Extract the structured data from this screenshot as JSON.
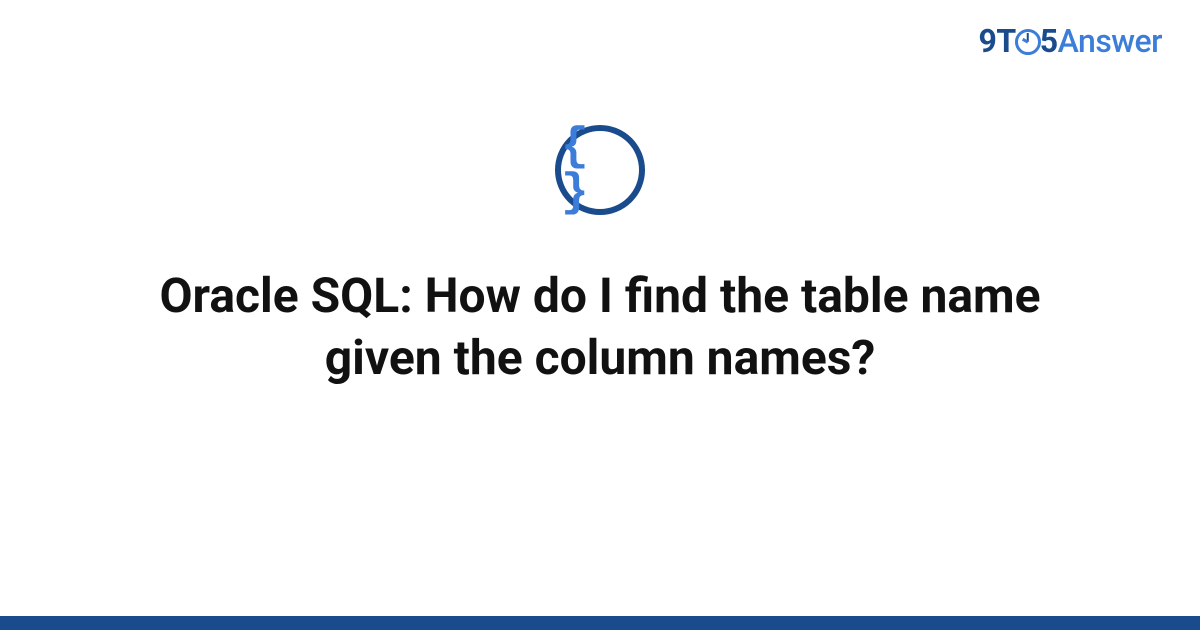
{
  "logo": {
    "nine": "9",
    "t": "T",
    "five": "5",
    "answer": "Answer"
  },
  "icon": {
    "glyph": "{ }",
    "name": "code-braces"
  },
  "title": "Oracle SQL: How do I find the table name given the column names?",
  "colors": {
    "brand_dark": "#1a4b8c",
    "brand_light": "#3b7dd8",
    "text": "#111111",
    "background": "#ffffff"
  }
}
